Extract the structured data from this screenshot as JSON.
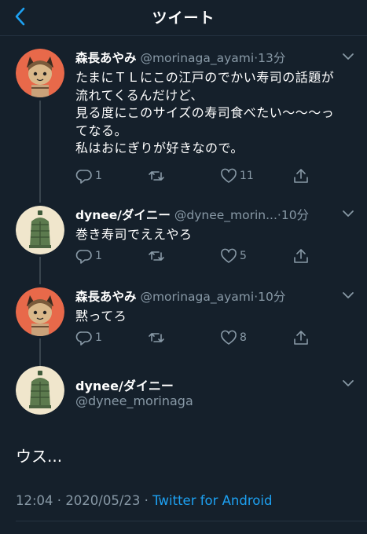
{
  "header": {
    "title": "ツイート"
  },
  "replies": [
    {
      "name": "森長あやみ",
      "handle": "@morinaga_ayami",
      "time": "13分",
      "text": "たまにＴＬにこの江戸のでかい寿司の話題が\n流れてくるんだけど、\n見る度にこのサイズの寿司食べたい〜〜〜っ\nてなる。\n私はおにぎりが好きなので。",
      "reply_count": "1",
      "retweet_count": "",
      "like_count": "11"
    },
    {
      "name": "dynee/ダイニー",
      "handle": "@dynee_morin...",
      "time": "10分",
      "text": "巻き寿司でええやろ",
      "reply_count": "1",
      "retweet_count": "",
      "like_count": "5"
    },
    {
      "name": "森長あやみ",
      "handle": "@morinaga_ayami",
      "time": "10分",
      "text": "黙ってろ",
      "reply_count": "1",
      "retweet_count": "",
      "like_count": "8"
    }
  ],
  "main_tweet": {
    "name": "dynee/ダイニー",
    "handle": "@dynee_morinaga",
    "text": "ウス...",
    "time": "12:04",
    "date": "2020/05/23",
    "source": "Twitter for Android"
  },
  "colors": {
    "background": "#15202b",
    "secondary_text": "#8899a6",
    "accent": "#1da1f2"
  },
  "icons": [
    "back-arrow-icon",
    "chevron-down-icon",
    "reply-icon",
    "retweet-icon",
    "like-icon",
    "share-icon"
  ]
}
